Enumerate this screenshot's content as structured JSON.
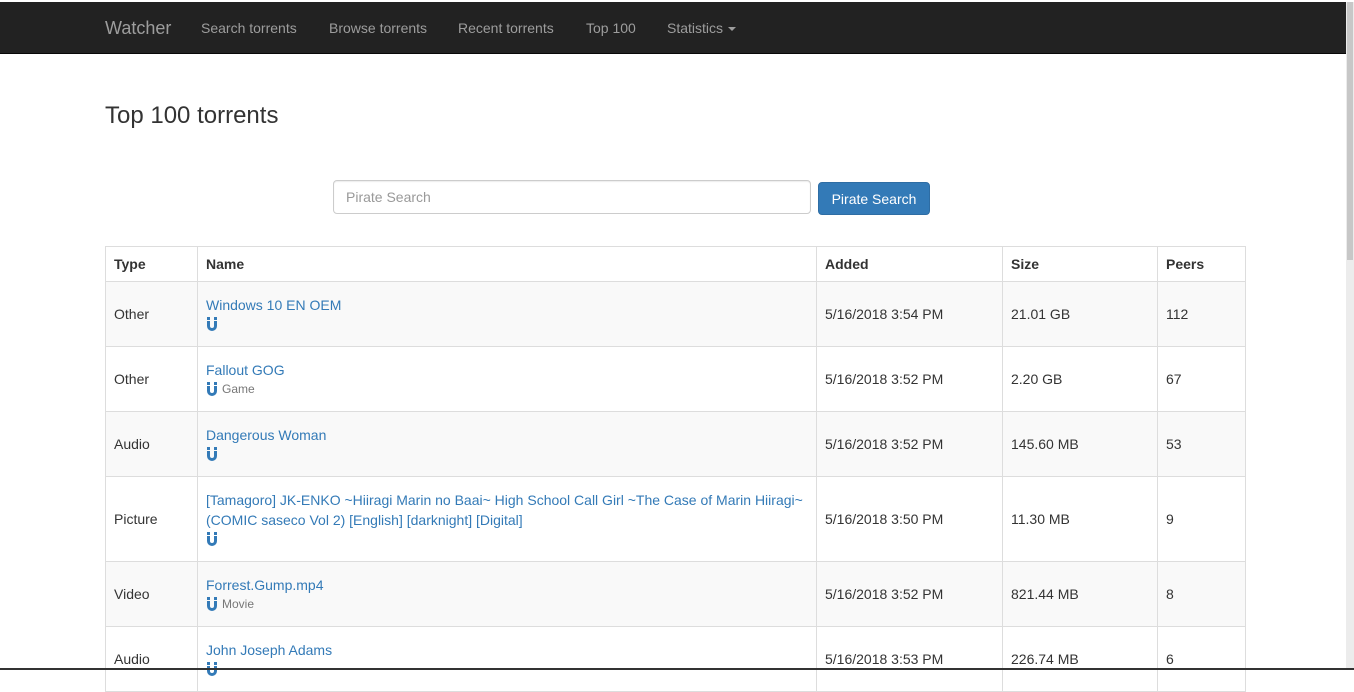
{
  "nav": {
    "brand": "Watcher",
    "links": [
      "Search torrents",
      "Browse torrents",
      "Recent torrents",
      "Top 100"
    ],
    "dropdown_label": "Statistics"
  },
  "page": {
    "title": "Top 100 torrents"
  },
  "search": {
    "placeholder": "Pirate Search",
    "button_label": "Pirate Search"
  },
  "table": {
    "headers": {
      "type": "Type",
      "name": "Name",
      "added": "Added",
      "size": "Size",
      "peers": "Peers"
    },
    "rows": [
      {
        "type": "Other",
        "name": "Windows 10 EN OEM",
        "category": "",
        "added": "5/16/2018 3:54 PM",
        "size": "21.01 GB",
        "peers": "112"
      },
      {
        "type": "Other",
        "name": "Fallout GOG",
        "category": "Game",
        "added": "5/16/2018 3:52 PM",
        "size": "2.20 GB",
        "peers": "67"
      },
      {
        "type": "Audio",
        "name": "Dangerous Woman",
        "category": "",
        "added": "5/16/2018 3:52 PM",
        "size": "145.60 MB",
        "peers": "53"
      },
      {
        "type": "Picture",
        "name": "[Tamagoro] JK-ENKO ~Hiiragi Marin no Baai~ High School Call Girl ~The Case of Marin Hiiragi~ (COMIC saseco Vol 2) [English] [darknight] [Digital]",
        "category": "",
        "added": "5/16/2018 3:50 PM",
        "size": "11.30 MB",
        "peers": "9"
      },
      {
        "type": "Video",
        "name": "Forrest.Gump.mp4",
        "category": "Movie",
        "added": "5/16/2018 3:52 PM",
        "size": "821.44 MB",
        "peers": "8"
      },
      {
        "type": "Audio",
        "name": "John Joseph Adams",
        "category": "",
        "added": "5/16/2018 3:53 PM",
        "size": "226.74 MB",
        "peers": "6"
      }
    ]
  },
  "colors": {
    "navbar": "#222222",
    "link": "#337ab7",
    "button": "#337ab7",
    "stripe": "#f9f9f9"
  }
}
